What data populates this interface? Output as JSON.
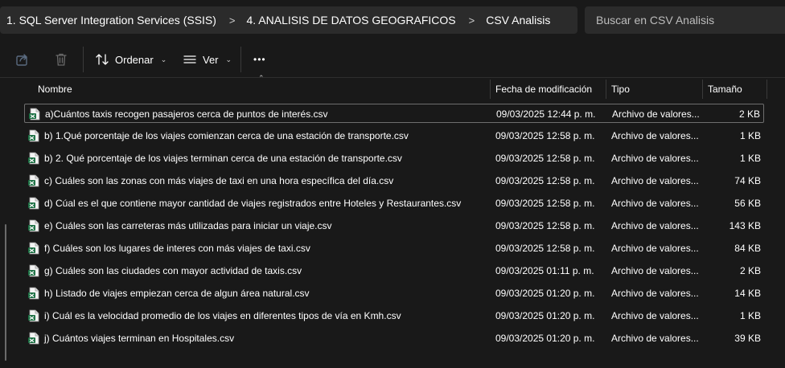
{
  "breadcrumb": {
    "items": [
      "1. SQL Server Integration Services (SSIS)",
      "4. ANALISIS DE DATOS GEOGRAFICOS",
      "CSV Analisis"
    ],
    "separator": ">"
  },
  "search": {
    "placeholder": "Buscar en CSV Analisis"
  },
  "toolbar": {
    "share_icon": "share-icon",
    "delete_icon": "trash-icon",
    "sort_label": "Ordenar",
    "view_label": "Ver",
    "more_label": "•••"
  },
  "columns": {
    "name": "Nombre",
    "date": "Fecha de modificación",
    "type": "Tipo",
    "size": "Tamaño"
  },
  "files": [
    {
      "name": "a)Cuántos taxis recogen pasajeros cerca de puntos de interés.csv",
      "date": "09/03/2025 12:44 p. m.",
      "type": "Archivo de valores...",
      "size": "2 KB",
      "selected": true
    },
    {
      "name": "b) 1.Qué porcentaje de los viajes comienzan cerca de una estación de transporte.csv",
      "date": "09/03/2025 12:58 p. m.",
      "type": "Archivo de valores...",
      "size": "1 KB"
    },
    {
      "name": "b) 2. Qué porcentaje de los viajes terminan cerca de una estación de transporte.csv",
      "date": "09/03/2025 12:58 p. m.",
      "type": "Archivo de valores...",
      "size": "1 KB"
    },
    {
      "name": "c) Cuáles son las zonas con más viajes de taxi en una hora específica del día.csv",
      "date": "09/03/2025 12:58 p. m.",
      "type": "Archivo de valores...",
      "size": "74 KB"
    },
    {
      "name": "d) Cúal es el que contiene mayor cantidad de viajes registrados entre Hoteles y Restaurantes.csv",
      "date": "09/03/2025 12:58 p. m.",
      "type": "Archivo de valores...",
      "size": "56 KB"
    },
    {
      "name": "e) Cuáles son las carreteras más utilizadas para iniciar un viaje.csv",
      "date": "09/03/2025 12:58 p. m.",
      "type": "Archivo de valores...",
      "size": "143 KB"
    },
    {
      "name": "f) Cuáles son los lugares de interes con más viajes de taxi.csv",
      "date": "09/03/2025 12:58 p. m.",
      "type": "Archivo de valores...",
      "size": "84 KB"
    },
    {
      "name": "g) Cuáles son las ciudades con mayor actividad de taxis.csv",
      "date": "09/03/2025 01:11 p. m.",
      "type": "Archivo de valores...",
      "size": "2 KB"
    },
    {
      "name": "h) Listado de viajes empiezan cerca de algun área natural.csv",
      "date": "09/03/2025 01:20 p. m.",
      "type": "Archivo de valores...",
      "size": "14 KB"
    },
    {
      "name": "i) Cuál es la velocidad promedio de los viajes en diferentes tipos de vía en Kmh.csv",
      "date": "09/03/2025 01:20 p. m.",
      "type": "Archivo de valores...",
      "size": "1 KB"
    },
    {
      "name": "j) Cuántos viajes terminan en Hospitales.csv",
      "date": "09/03/2025 01:20 p. m.",
      "type": "Archivo de valores...",
      "size": "39 KB"
    }
  ],
  "colors": {
    "background": "#191919",
    "bar": "#2b2b2b",
    "csv_icon": "#1e7145"
  }
}
